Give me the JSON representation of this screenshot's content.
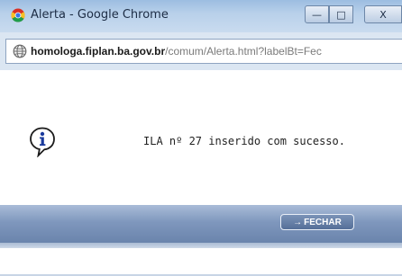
{
  "window": {
    "title": "Alerta - Google Chrome",
    "min_glyph": "—",
    "max_glyph": "□",
    "close_glyph": "X"
  },
  "address": {
    "host": "homologa.fiplan.ba.gov.br",
    "path": "/comum/Alerta.html?labelBt=Fec"
  },
  "alert": {
    "message": "ILA nº 27 inserido com sucesso."
  },
  "footer": {
    "button_label": "FECHAR",
    "button_arrow": "→"
  },
  "colors": {
    "titlebar": "#b8d0ea",
    "footerbar": "#7f97bd",
    "button": "#5f78a1"
  },
  "icons": {
    "app": "chrome-icon",
    "address": "globe-icon",
    "alert": "info-icon",
    "button": "arrow-right-icon"
  }
}
